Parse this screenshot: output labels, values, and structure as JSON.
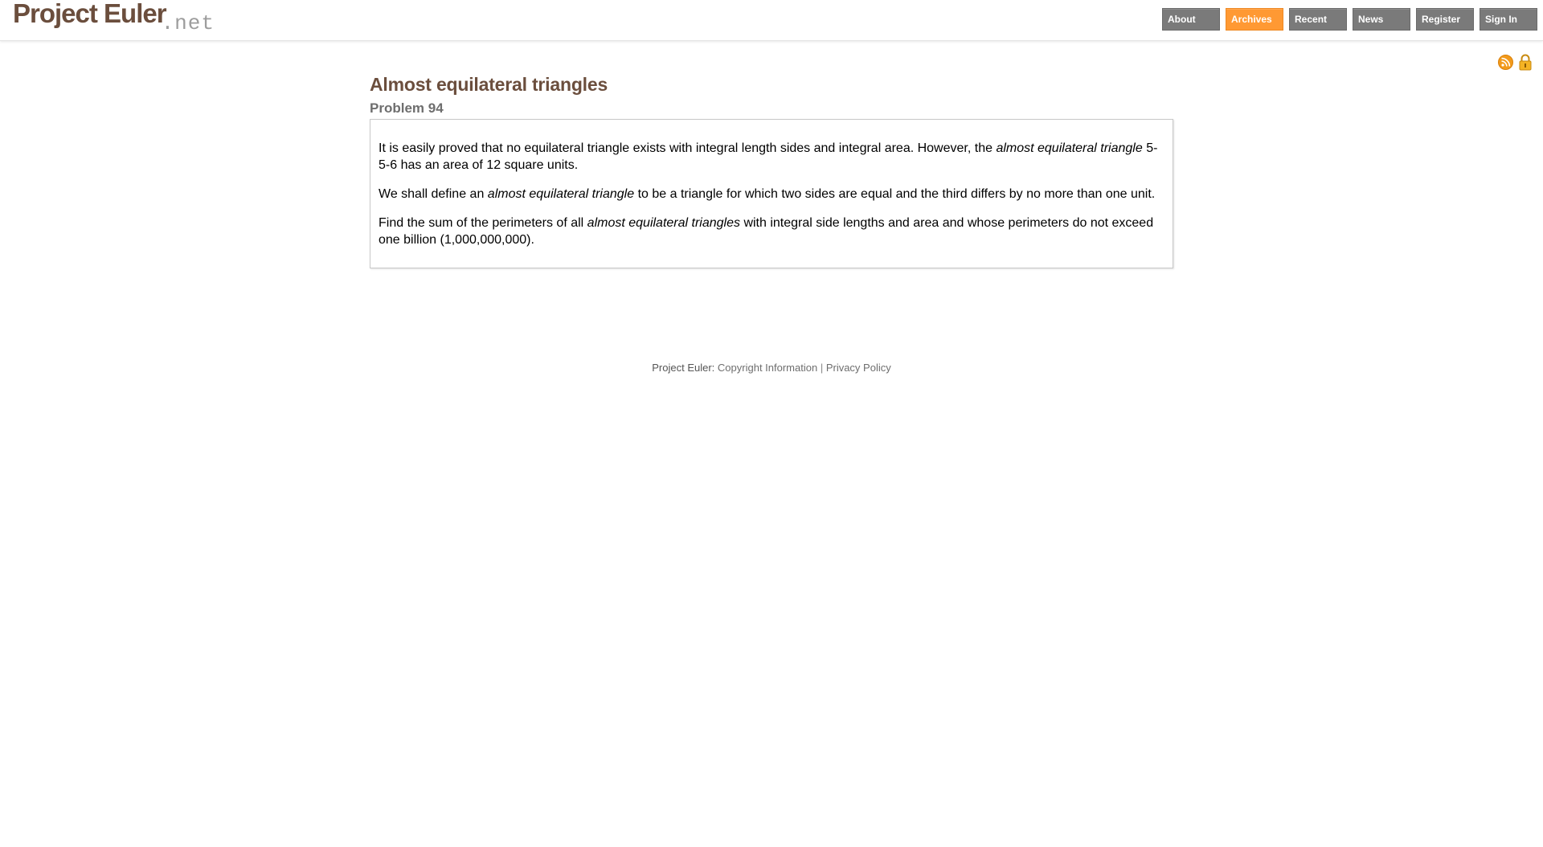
{
  "header": {
    "logo_main": "Project Euler",
    "logo_suffix": ".net",
    "nav": [
      {
        "label": "About",
        "active": false
      },
      {
        "label": "Archives",
        "active": true
      },
      {
        "label": "Recent",
        "active": false
      },
      {
        "label": "News",
        "active": false
      },
      {
        "label": "Register",
        "active": false
      },
      {
        "label": "Sign In",
        "active": false
      }
    ],
    "icons": [
      "rss-icon",
      "lock-icon"
    ]
  },
  "problem": {
    "title": "Almost equilateral triangles",
    "number_label": "Problem 94",
    "paragraphs": [
      {
        "before": "It is easily proved that no equilateral triangle exists with integral length sides and integral area. However, the ",
        "em": "almost equilateral triangle",
        "after": " 5-5-6 has an area of 12 square units."
      },
      {
        "before": "We shall define an ",
        "em": "almost equilateral triangle",
        "after": " to be a triangle for which two sides are equal and the third differs by no more than one unit."
      },
      {
        "before": "Find the sum of the perimeters of all ",
        "em": "almost equilateral triangles",
        "after": " with integral side lengths and area and whose perimeters do not exceed one billion (1,000,000,000)."
      }
    ]
  },
  "footer": {
    "prefix": "Project Euler: ",
    "copyright_link": "Copyright Information",
    "separator": " | ",
    "privacy_link": "Privacy Policy"
  },
  "colors": {
    "brand_brown": "#6b4e3d",
    "nav_gray": "#7a7a7a",
    "nav_active": "#ff9933"
  }
}
